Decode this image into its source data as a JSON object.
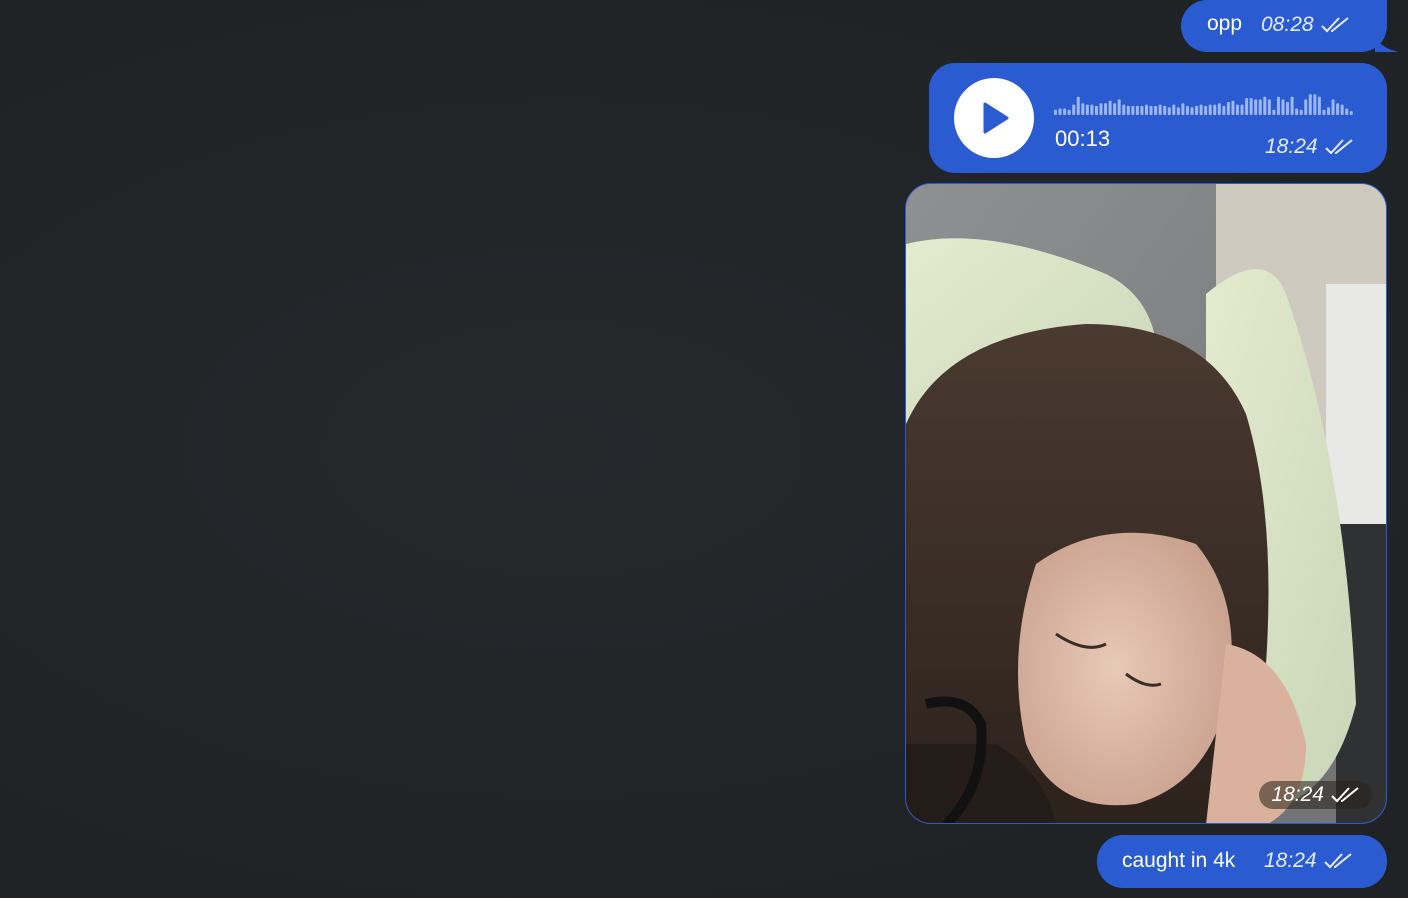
{
  "messages": [
    {
      "type": "text",
      "text": "opp",
      "time": "08:28",
      "status_icon": "double-check-icon"
    },
    {
      "type": "voice",
      "duration": "00:13",
      "time": "18:24",
      "status_icon": "double-check-icon"
    },
    {
      "type": "photo",
      "time": "18:24",
      "status_icon": "double-check-icon"
    },
    {
      "type": "text",
      "text": "caught in 4k",
      "time": "18:24",
      "status_icon": "double-check-icon"
    }
  ],
  "colors": {
    "bubble_outgoing": "#2a5bd0",
    "background": "#222528",
    "meta_text": "#e6ecff"
  }
}
